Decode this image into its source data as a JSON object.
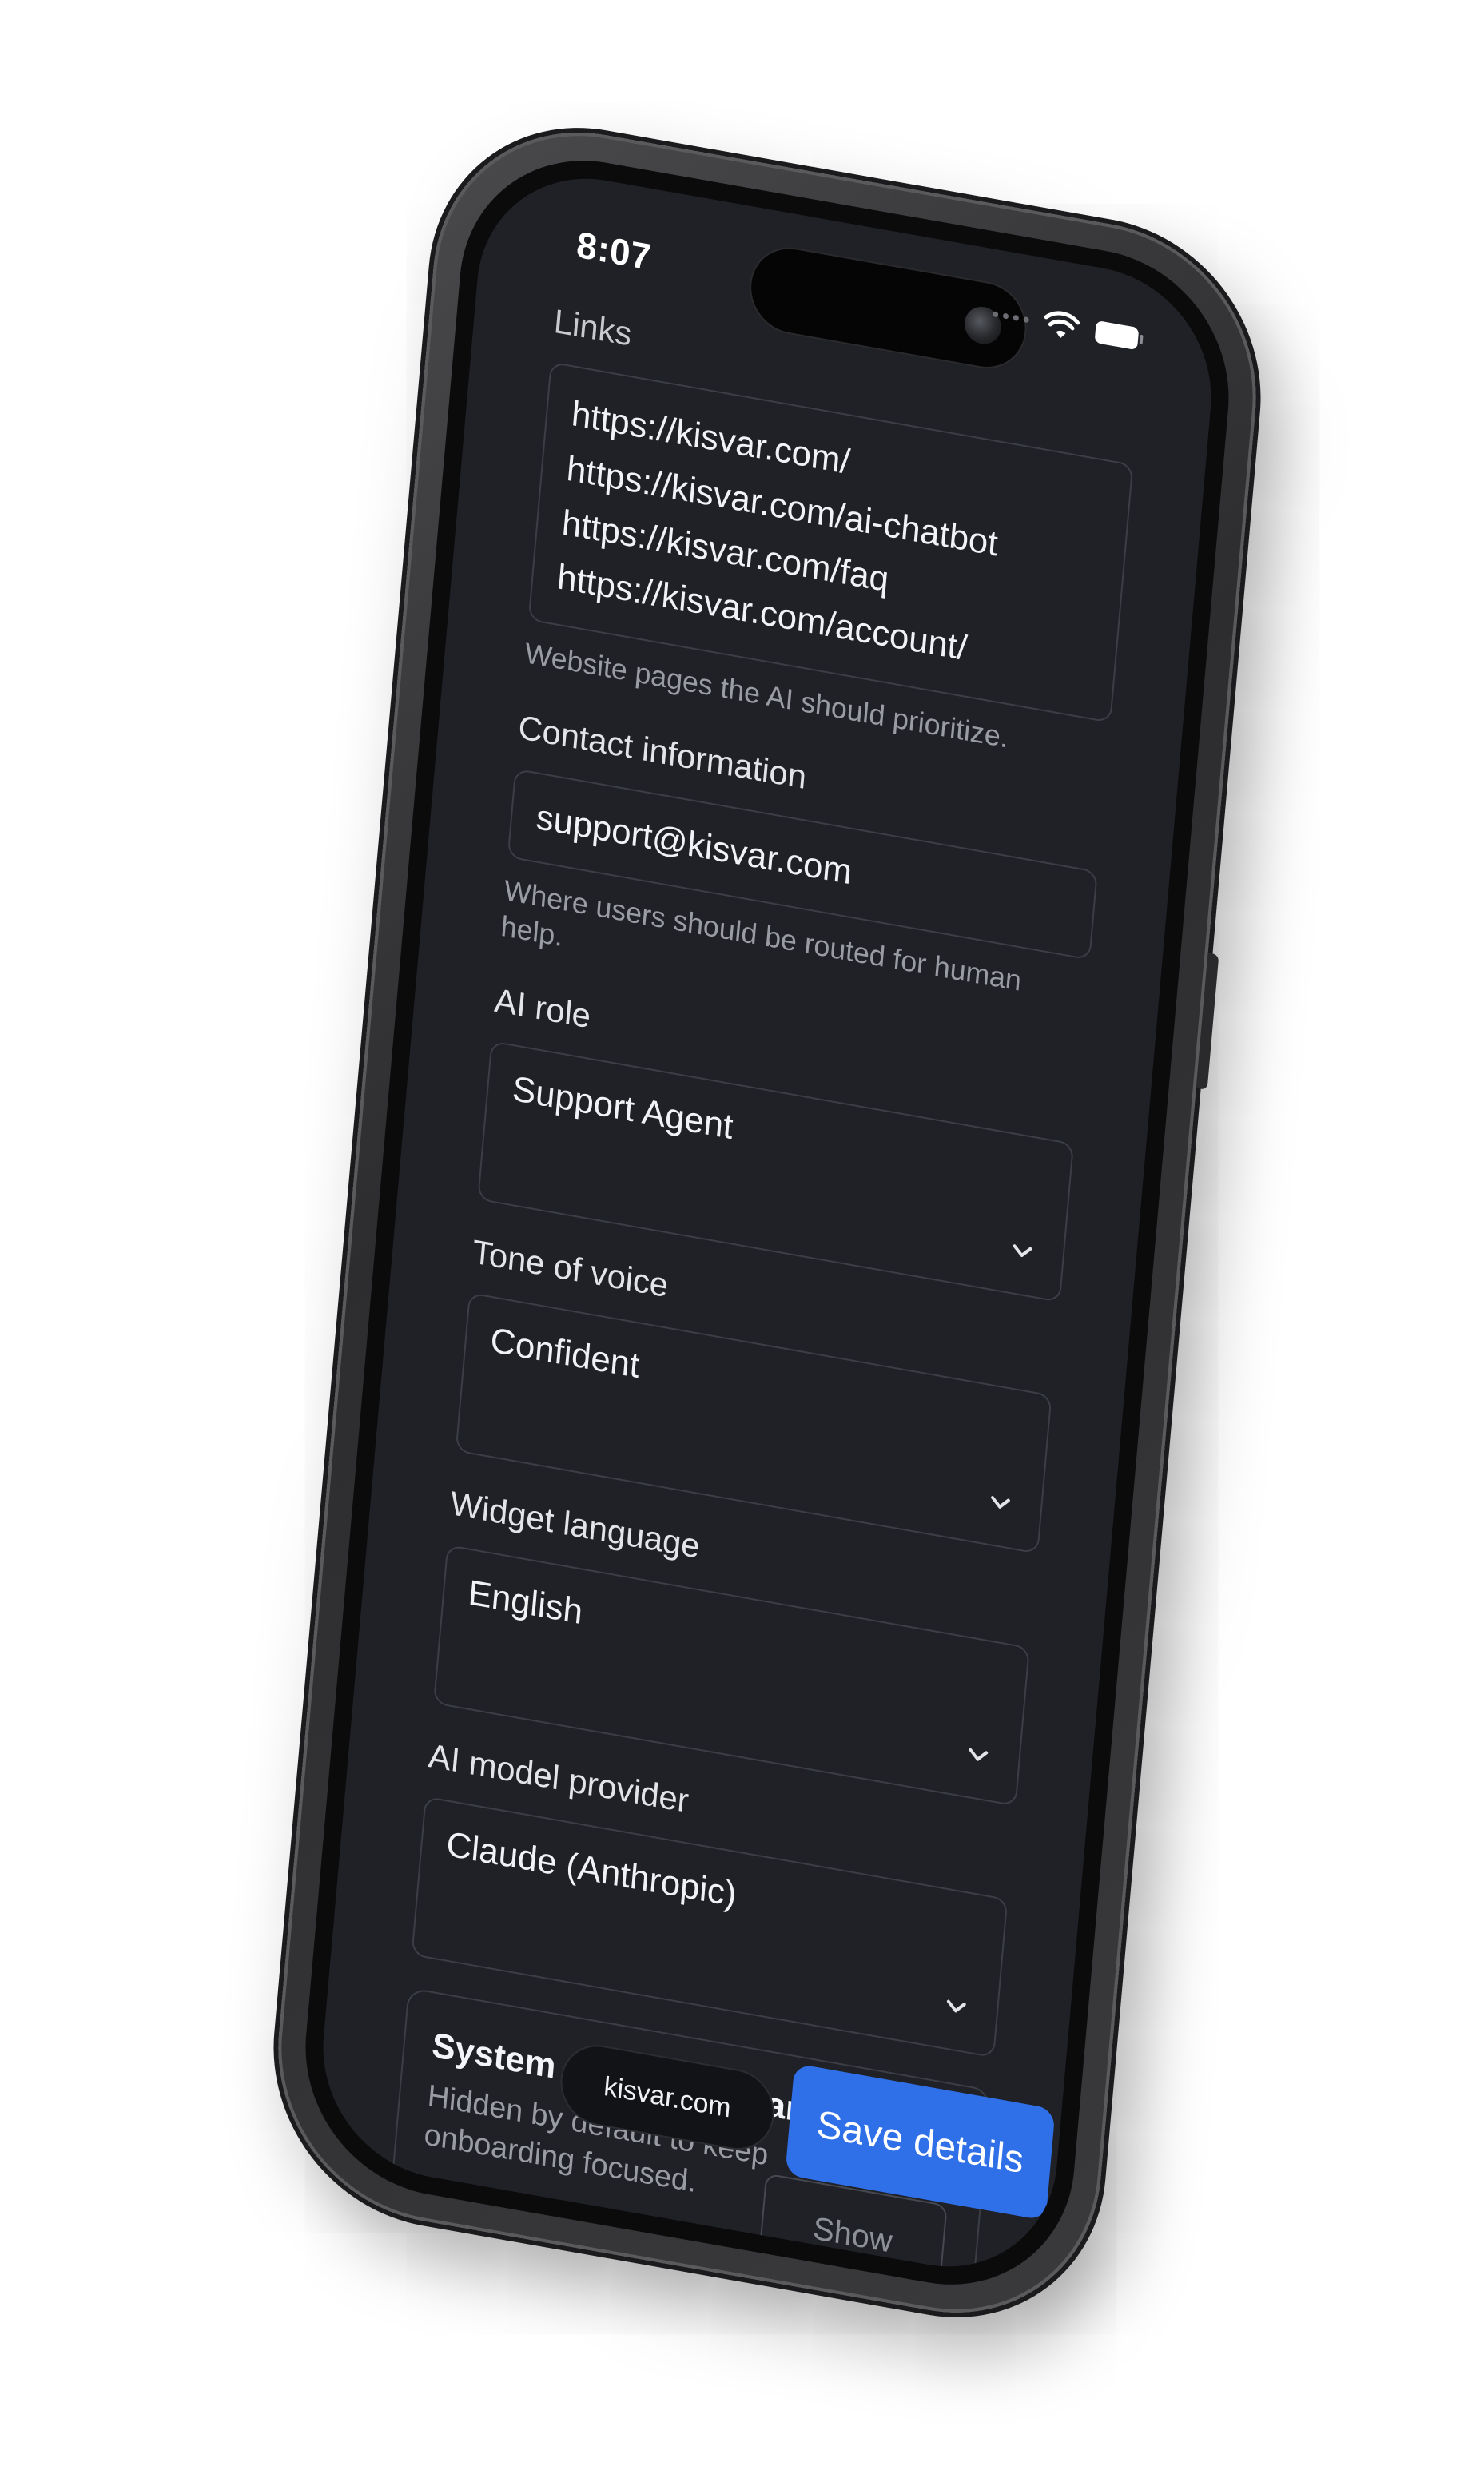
{
  "status_bar": {
    "time": "8:07"
  },
  "links": {
    "label": "Links",
    "lines": [
      "https://kisvar.com/",
      "https://kisvar.com/ai-chatbot",
      "https://kisvar.com/faq",
      "https://kisvar.com/account/"
    ],
    "hint": "Website pages the AI should prioritize."
  },
  "contact": {
    "label": "Contact information",
    "value": "support@kisvar.com",
    "hint": "Where users should be routed for human help."
  },
  "ai_role": {
    "label": "AI role",
    "value": "Support Agent"
  },
  "tone": {
    "label": "Tone of voice",
    "value": "Confident"
  },
  "language": {
    "label": "Widget language",
    "value": "English"
  },
  "provider": {
    "label": "AI model provider",
    "value": "Claude (Anthropic)"
  },
  "system_prompt": {
    "title": "System prompt (advanced)",
    "description": "Hidden by default to keep onboarding focused.",
    "button_label": "Show prompt"
  },
  "footer": {
    "domain": "kisvar.com",
    "save_label": "Save details"
  },
  "colors": {
    "screen_bg": "#1f2126",
    "accent": "#2f6fe8",
    "border": "#3b3e45"
  }
}
